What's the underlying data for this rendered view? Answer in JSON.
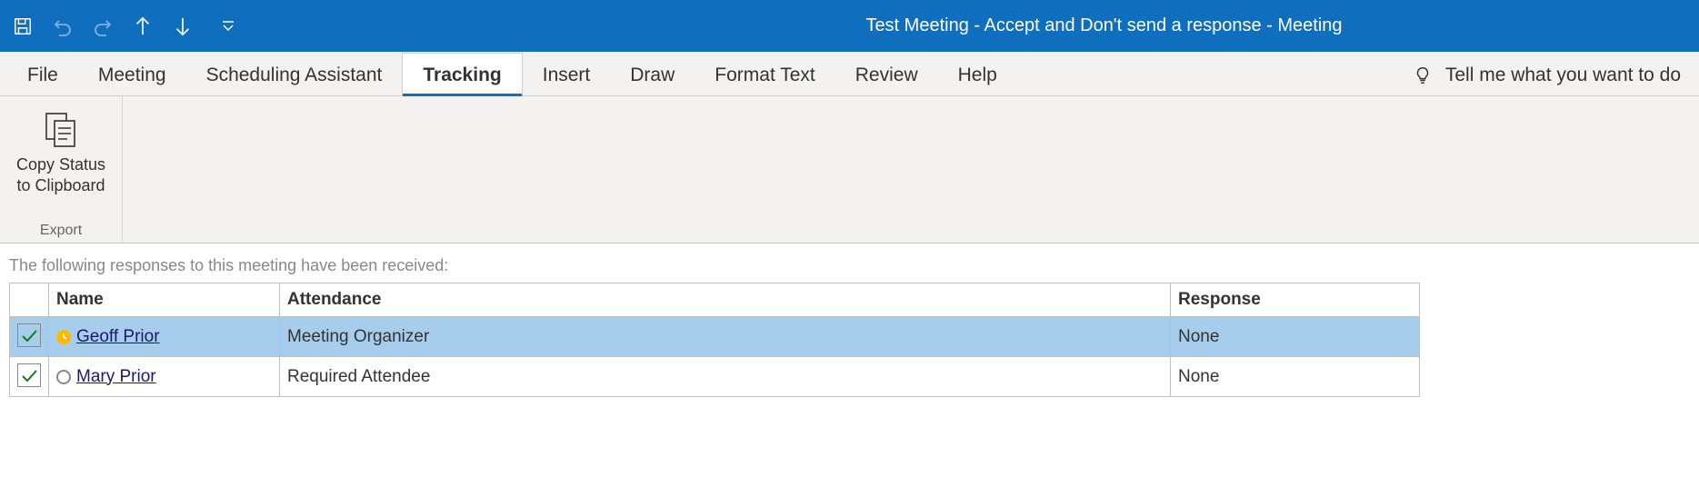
{
  "titlebar": {
    "title": "Test Meeting - Accept and Don't send a response  -  Meeting"
  },
  "tabs": {
    "file": "File",
    "meeting": "Meeting",
    "scheduling": "Scheduling Assistant",
    "tracking": "Tracking",
    "insert": "Insert",
    "draw": "Draw",
    "format_text": "Format Text",
    "review": "Review",
    "help": "Help",
    "tellme": "Tell me what you want to do"
  },
  "ribbon": {
    "copy_status_label": "Copy Status\nto Clipboard",
    "export_group": "Export"
  },
  "content": {
    "info": "The following responses to this meeting have been received:",
    "columns": {
      "name": "Name",
      "attendance": "Attendance",
      "response": "Response"
    },
    "rows": [
      {
        "name": "Geoff Prior",
        "attendance": "Meeting Organizer",
        "response": "None",
        "presence": "away",
        "checked": true,
        "selected": true
      },
      {
        "name": "Mary Prior",
        "attendance": "Required Attendee",
        "response": "None",
        "presence": "offline",
        "checked": true,
        "selected": false
      }
    ]
  }
}
